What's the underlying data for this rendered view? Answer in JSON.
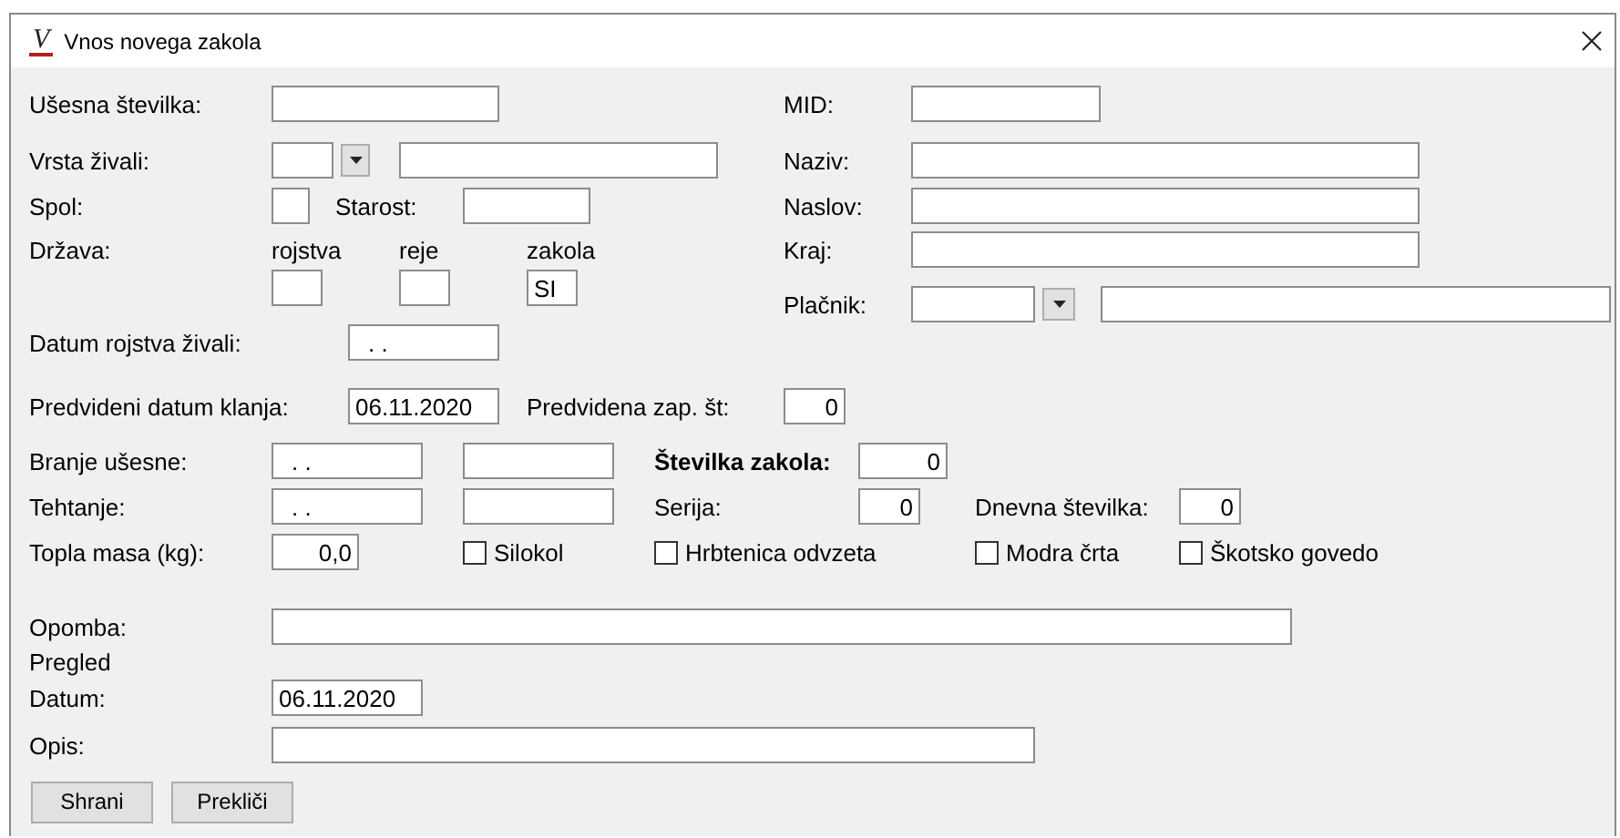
{
  "window": {
    "title": "Vnos novega zakola",
    "app_icon": "V"
  },
  "ear_number": {
    "label": "Ušesna številka:"
  },
  "mid": {
    "label": "MID:"
  },
  "animal_type": {
    "label": "Vrsta živali:"
  },
  "name": {
    "label": "Naziv:"
  },
  "sex": {
    "label": "Spol:"
  },
  "age": {
    "label": "Starost:"
  },
  "address": {
    "label": "Naslov:"
  },
  "country": {
    "label": "Država:",
    "columns": [
      {
        "label": "rojstva"
      },
      {
        "label": "reje"
      },
      {
        "label": "zakola",
        "value": "SI"
      }
    ]
  },
  "city": {
    "label": "Kraj:"
  },
  "payer": {
    "label": "Plačnik:"
  },
  "birth_date": {
    "label": "Datum rojstva živali:",
    "value": ". ."
  },
  "planned_date": {
    "label": "Predvideni datum klanja:",
    "value": "06.11.2020"
  },
  "planned_seq": {
    "label": "Predvidena zap. št:",
    "value": "0"
  },
  "ear_reading": {
    "label": "Branje ušesne:",
    "value": ". ."
  },
  "slaughter_number": {
    "label": "Številka zakola:",
    "value": "0"
  },
  "weighing": {
    "label": "Tehtanje:",
    "value": ". ."
  },
  "series": {
    "label": "Serija:",
    "value": "0"
  },
  "daily_number": {
    "label": "Dnevna številka:",
    "value": "0"
  },
  "warm_mass": {
    "label": "Topla masa (kg):",
    "value": "0,0"
  },
  "checkboxes": [
    {
      "label": "Silokol",
      "checked": false
    },
    {
      "label": "Hrbtenica odvzeta",
      "checked": false
    },
    {
      "label": "Modra črta",
      "checked": false
    },
    {
      "label": "Škotsko govedo",
      "checked": false
    }
  ],
  "note": {
    "label": "Opomba:"
  },
  "review": {
    "title": "Pregled",
    "date": {
      "label": "Datum:",
      "value": "06.11.2020"
    },
    "description": {
      "label": "Opis:"
    }
  },
  "buttons": [
    "Shrani",
    "Prekliči"
  ]
}
